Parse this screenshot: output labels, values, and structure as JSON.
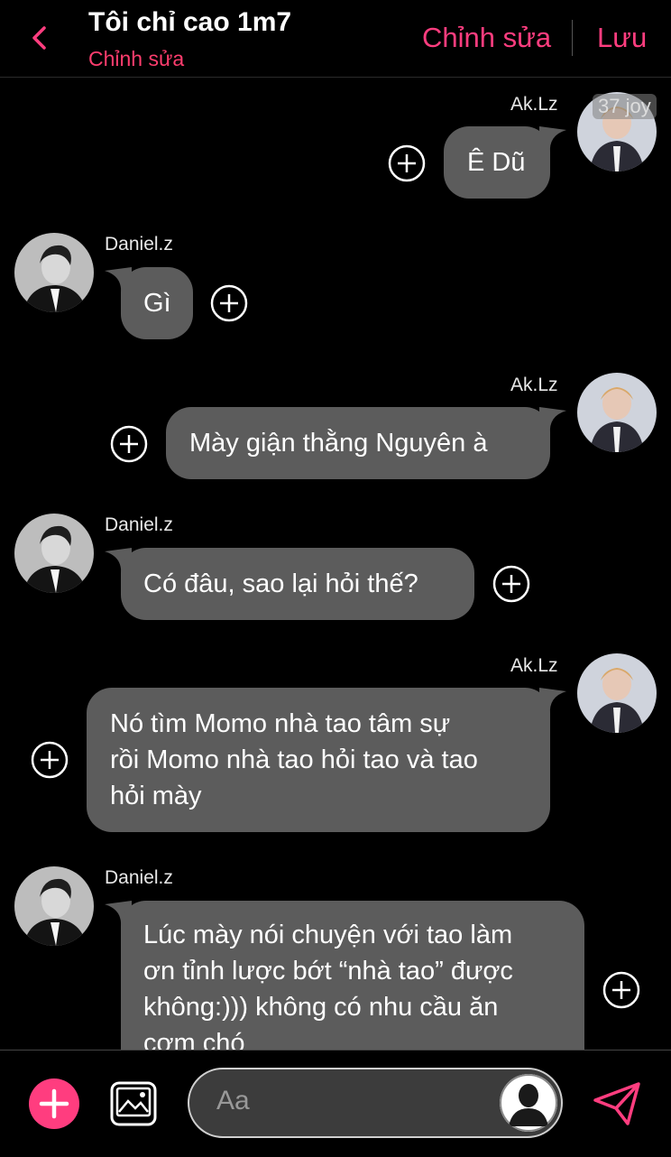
{
  "header": {
    "title": "Tôi chỉ cao 1m7",
    "subtitle": "Chỉnh sửa",
    "edit_label": "Chỉnh sửa",
    "save_label": "Lưu"
  },
  "watermark": "37 joy",
  "messages": [
    {
      "sender": "Ak.Lz",
      "side": "right",
      "text": "Ê Dũ"
    },
    {
      "sender": "Daniel.z",
      "side": "left",
      "text": "Gì"
    },
    {
      "sender": "Ak.Lz",
      "side": "right",
      "text": "Mày giận thằng Nguyên à"
    },
    {
      "sender": "Daniel.z",
      "side": "left",
      "text": "Có đâu, sao lại hỏi thế?"
    },
    {
      "sender": "Ak.Lz",
      "side": "right",
      "text_lines": [
        "Nó tìm Momo nhà tao tâm sự",
        "rồi Momo nhà tao hỏi tao và tao",
        "hỏi mày"
      ]
    },
    {
      "sender": "Daniel.z",
      "side": "left",
      "text_lines": [
        "Lúc mày nói chuyện với tao làm",
        "ơn tỉnh lược bớt “nhà tao” được",
        "không:))) không có nhu cầu ăn",
        "cơm chó"
      ]
    }
  ],
  "composer": {
    "placeholder": "Aa"
  },
  "colors": {
    "accent": "#ff3d7f",
    "bubble": "#5c5c5c",
    "background": "#000000"
  },
  "icons": [
    "back-chevron-icon",
    "add-reaction-icon",
    "plus-icon",
    "image-icon",
    "send-icon",
    "user-silhouette-icon"
  ]
}
